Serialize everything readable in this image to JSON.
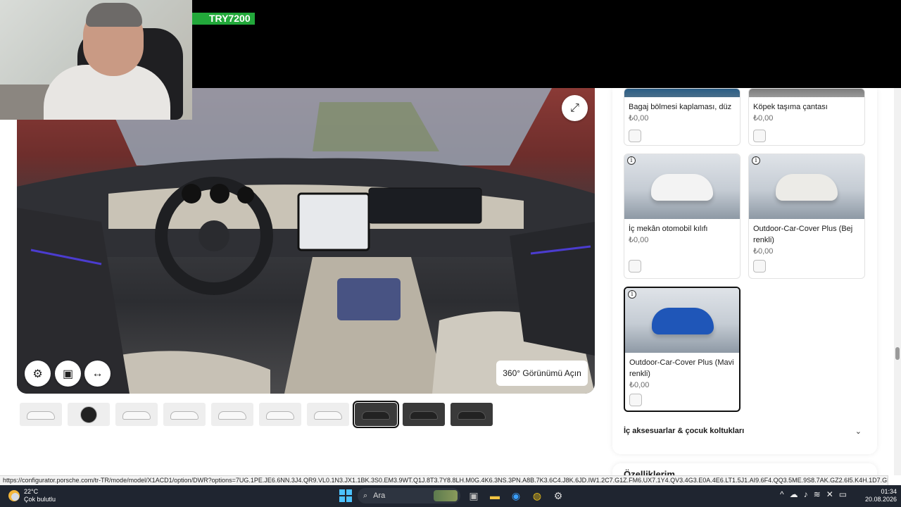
{
  "overlay": {
    "badge_text": "TRY7200"
  },
  "viewer": {
    "cta_360": "360° Görünümü Açın",
    "icons": [
      "settings-icon",
      "camera-icon",
      "resize-icon",
      "fullscreen-icon"
    ],
    "thumbnail_count": 10,
    "active_thumbnail": 8
  },
  "accessories": {
    "items": [
      {
        "name": "Bagaj bölmesi kaplaması, düz",
        "price": "₺0,00"
      },
      {
        "name": "Köpek taşıma çantası",
        "price": "₺0,00"
      },
      {
        "name": "İç mekân otomobil kılıfı",
        "price": "₺0,00"
      },
      {
        "name": "Outdoor-Car-Cover Plus (Bej renkli)",
        "price": "₺0,00"
      },
      {
        "name": "Outdoor-Car-Cover Plus (Mavi renkli)",
        "price": "₺0,00"
      }
    ],
    "section_label": "İç aksesuarlar & çocuk koltukları",
    "next_section_label": "Özelliklerim"
  },
  "status_bar": {
    "url": "https://configurator.porsche.com/tr-TR/mode/model/X1ACD1/option/DWR?options=7UG.1PE.JE6.6NN.3J4.QR9.VL0.1N3.JX1.1BK.3S0.EM3.9WT.Q1J.8T3.7Y8.8LH.M0G.4K6.3NS.3PN.A8B.7K3.6C4.J8K.6JD.IW1.2C7.G1Z.FM6.UX7.1Y4.QV3.4G3.E0A.4E6.LT1.5J1.AI9.6F4.QQ3.5ME.9S8.7AK.GZ2.6I5.K4H.1D7.GM3.4UE.VF1.GV1.1LQ.2V3.YZF.QE1.3FV.6E7.FX2.66K.FC1..."
  },
  "taskbar": {
    "weather_temp": "22°C",
    "weather_desc": "Çok bulutlu",
    "search_placeholder": "Ara",
    "time": "01:34",
    "date": "20.08.2026"
  },
  "colors": {
    "badge": "#22a83a",
    "selected_border": "#111111",
    "taskbar": "#1f2530",
    "accent_blue": "#1f56b8"
  }
}
